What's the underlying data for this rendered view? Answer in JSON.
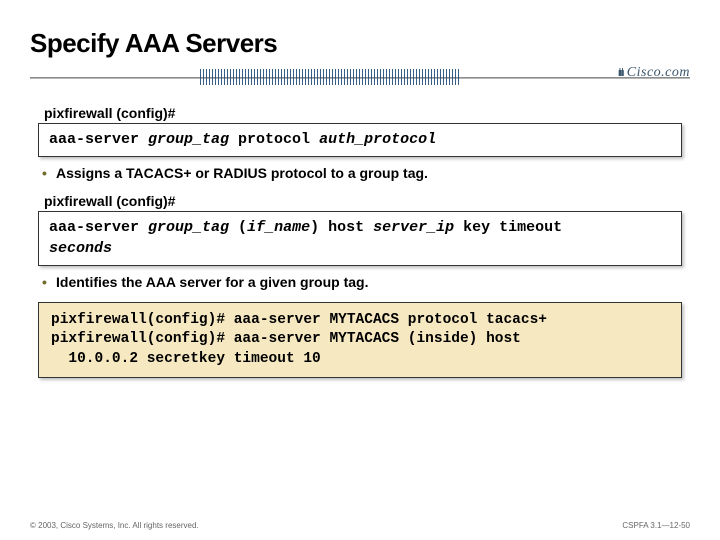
{
  "title": "Specify AAA Servers",
  "brand": {
    "name": "Cisco.com"
  },
  "prompt": "pixfirewall (config)#",
  "cmd1": {
    "prefix": "aaa-server ",
    "arg1": "group_tag",
    "mid": " protocol ",
    "arg2": "auth_protocol"
  },
  "bullet1": "Assigns a TACACS+ or RADIUS protocol to a group tag.",
  "cmd2": {
    "prefix": "aaa-server ",
    "arg1": "group_tag",
    "p2a": " (",
    "arg2": "if_name",
    "p2b": ") host ",
    "arg3": "server_ip",
    "p3": " key timeout",
    "indent": "  ",
    "arg4": "seconds"
  },
  "bullet2": "Identifies the AAA server for a given group tag.",
  "example": {
    "l1": "pixfirewall(config)# aaa-server MYTACACS protocol tacacs+",
    "l2": "pixfirewall(config)# aaa-server MYTACACS (inside) host",
    "l3": "  10.0.0.2 secretkey timeout 10"
  },
  "footer": {
    "left": "© 2003, Cisco Systems, Inc. All rights reserved.",
    "right": "CSPFA 3.1—12-50"
  }
}
